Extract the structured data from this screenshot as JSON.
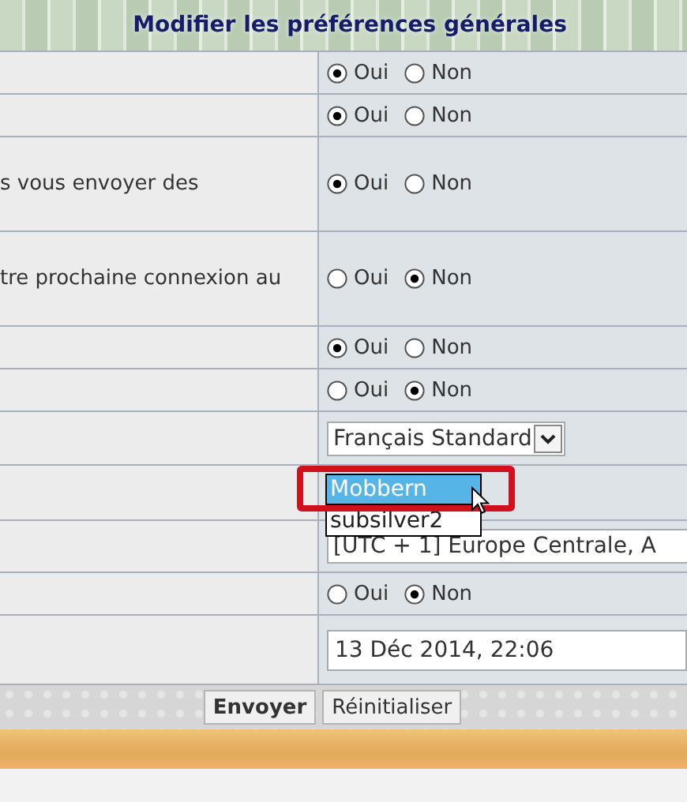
{
  "header": {
    "title": "Modifier les préférences générales"
  },
  "rows": [
    {
      "kind": "radio",
      "options": [
        {
          "label": "Oui",
          "selected": true
        },
        {
          "label": "Non",
          "selected": false
        }
      ]
    },
    {
      "kind": "radio",
      "options": [
        {
          "label": "Oui",
          "selected": true
        },
        {
          "label": "Non",
          "selected": false
        }
      ]
    },
    {
      "kind": "radio",
      "label": "s vous envoyer des",
      "options": [
        {
          "label": "Oui",
          "selected": true
        },
        {
          "label": "Non",
          "selected": false
        }
      ]
    },
    {
      "kind": "radio",
      "label": "tre prochaine connexion au",
      "options": [
        {
          "label": "Oui",
          "selected": false
        },
        {
          "label": "Non",
          "selected": true
        }
      ]
    },
    {
      "kind": "radio",
      "options": [
        {
          "label": "Oui",
          "selected": true
        },
        {
          "label": "Non",
          "selected": false
        }
      ]
    },
    {
      "kind": "radio",
      "options": [
        {
          "label": "Oui",
          "selected": false
        },
        {
          "label": "Non",
          "selected": true
        }
      ]
    },
    {
      "kind": "select",
      "value": "Français Standard"
    },
    {
      "kind": "dropdown",
      "options": [
        {
          "label": "Mobbern",
          "selected": true
        },
        {
          "label": "subsilver2",
          "selected": false
        }
      ]
    },
    {
      "kind": "select",
      "value": "[UTC + 1] Europe Centrale, A"
    },
    {
      "kind": "radio",
      "options": [
        {
          "label": "Oui",
          "selected": false
        },
        {
          "label": "Non",
          "selected": true
        }
      ]
    },
    {
      "kind": "text",
      "value": "13 Déc 2014, 22:06"
    }
  ],
  "buttons": [
    {
      "label": "Envoyer",
      "kind": "primary"
    },
    {
      "label": "Réinitialiser",
      "kind": "secondary"
    }
  ]
}
